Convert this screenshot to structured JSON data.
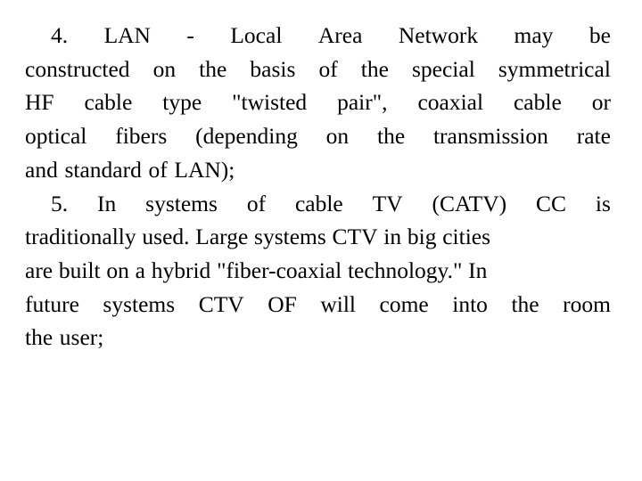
{
  "document": {
    "background_color": "#ffffff",
    "text_color": "#000000",
    "paragraphs": [
      {
        "id": "paragraph-4",
        "marker": "4.",
        "full_text": "4. LAN - Local Area Network may be constructed on the basis of the special symmetrical HF cable type \"twisted pair\", coaxial cable or optical fibers (depending on the transmission rate and standard of LAN);",
        "lines": [
          {
            "id": "p4-line-1",
            "text": "4. LAN - Local Area Network may be",
            "words": [
              "4.",
              "LAN",
              "-",
              "Local",
              "Area",
              "Network",
              "may",
              "be"
            ],
            "justified": true,
            "first": true,
            "last": false
          },
          {
            "id": "p4-line-2",
            "text": "constructed on the basis of the special symmetrical",
            "words": [
              "constructed",
              "on",
              "the",
              "basis",
              "of",
              "the",
              "special",
              "symmetrical"
            ],
            "justified": true,
            "first": false,
            "last": false
          },
          {
            "id": "p4-line-3",
            "text": "HF cable type \"twisted pair\", coaxial cable or",
            "words": [
              "HF",
              "cable",
              "type",
              "\"twisted",
              "pair\",",
              "coaxial",
              "cable",
              "or"
            ],
            "justified": true,
            "first": false,
            "last": false
          },
          {
            "id": "p4-line-4",
            "text": "optical fibers (depending on the transmission rate",
            "words": [
              "optical",
              "fibers",
              "(depending",
              "on",
              "the",
              "transmission",
              "rate"
            ],
            "justified": true,
            "first": false,
            "last": false
          },
          {
            "id": "p4-line-5",
            "text": "and standard of LAN);",
            "words": [
              "and",
              "standard",
              "of",
              "LAN);"
            ],
            "justified": false,
            "first": false,
            "last": true
          }
        ]
      },
      {
        "id": "paragraph-5",
        "marker": "5.",
        "full_text": "5. In systems of cable TV (CATV) CC is traditionally used. Large systems CTV in big cities are built on a hybrid \"fiber-coaxial technology.\" In future systems CTV OF will come into the room the user;",
        "lines": [
          {
            "id": "p5-line-1",
            "text": "5. In systems of cable TV (CATV) CC is",
            "words": [
              "5.",
              "In",
              "systems",
              "of",
              "cable",
              "TV",
              "(CATV)",
              "CC",
              "is"
            ],
            "justified": true,
            "first": true,
            "last": false
          },
          {
            "id": "p5-line-2",
            "text": "traditionally used. Large systems CTV in big cities",
            "words": [
              "traditionally",
              "used.",
              "Large",
              "systems",
              "CTV",
              "in",
              "big",
              "cities"
            ],
            "justified": true,
            "first": false,
            "last": false,
            "tight": true
          },
          {
            "id": "p5-line-3",
            "text": "are built on a hybrid \"fiber-coaxial technology.\" In",
            "words": [
              "are",
              "built",
              "on",
              "a",
              "hybrid",
              "\"fiber-coaxial",
              "technology.\"",
              "In"
            ],
            "justified": true,
            "first": false,
            "last": false,
            "tight": true
          },
          {
            "id": "p5-line-4",
            "text": "future systems CTV OF will come into the room",
            "words": [
              "future",
              "systems",
              "CTV",
              "OF",
              "will",
              "come",
              "into",
              "the",
              "room"
            ],
            "justified": true,
            "first": false,
            "last": false
          },
          {
            "id": "p5-line-5",
            "text": "the user;",
            "words": [
              "the",
              "user;"
            ],
            "justified": false,
            "first": false,
            "last": true
          }
        ]
      }
    ]
  }
}
